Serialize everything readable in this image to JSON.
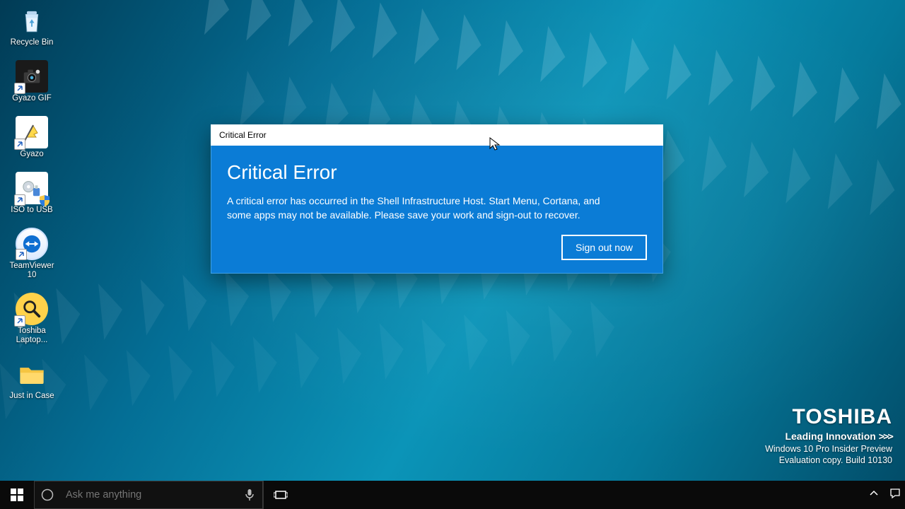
{
  "desktop_icons": [
    {
      "label": "Recycle Bin"
    },
    {
      "label": "Gyazo GIF"
    },
    {
      "label": "Gyazo"
    },
    {
      "label": "ISO to USB"
    },
    {
      "label": "TeamViewer 10"
    },
    {
      "label": "Toshiba Laptop..."
    },
    {
      "label": "Just in Case"
    }
  ],
  "dialog": {
    "title": "Critical Error",
    "heading": "Critical Error",
    "message": "A critical error has occurred in the Shell Infrastructure Host. Start Menu, Cortana, and some apps may not be available.  Please save your work and sign-out to recover.",
    "button": "Sign out now"
  },
  "branding": {
    "logo": "TOSHIBA",
    "tagline": "Leading Innovation",
    "line1": "Windows 10 Pro Insider Preview",
    "line2": "Evaluation copy. Build 10130"
  },
  "taskbar": {
    "search_placeholder": "Ask me anything"
  }
}
